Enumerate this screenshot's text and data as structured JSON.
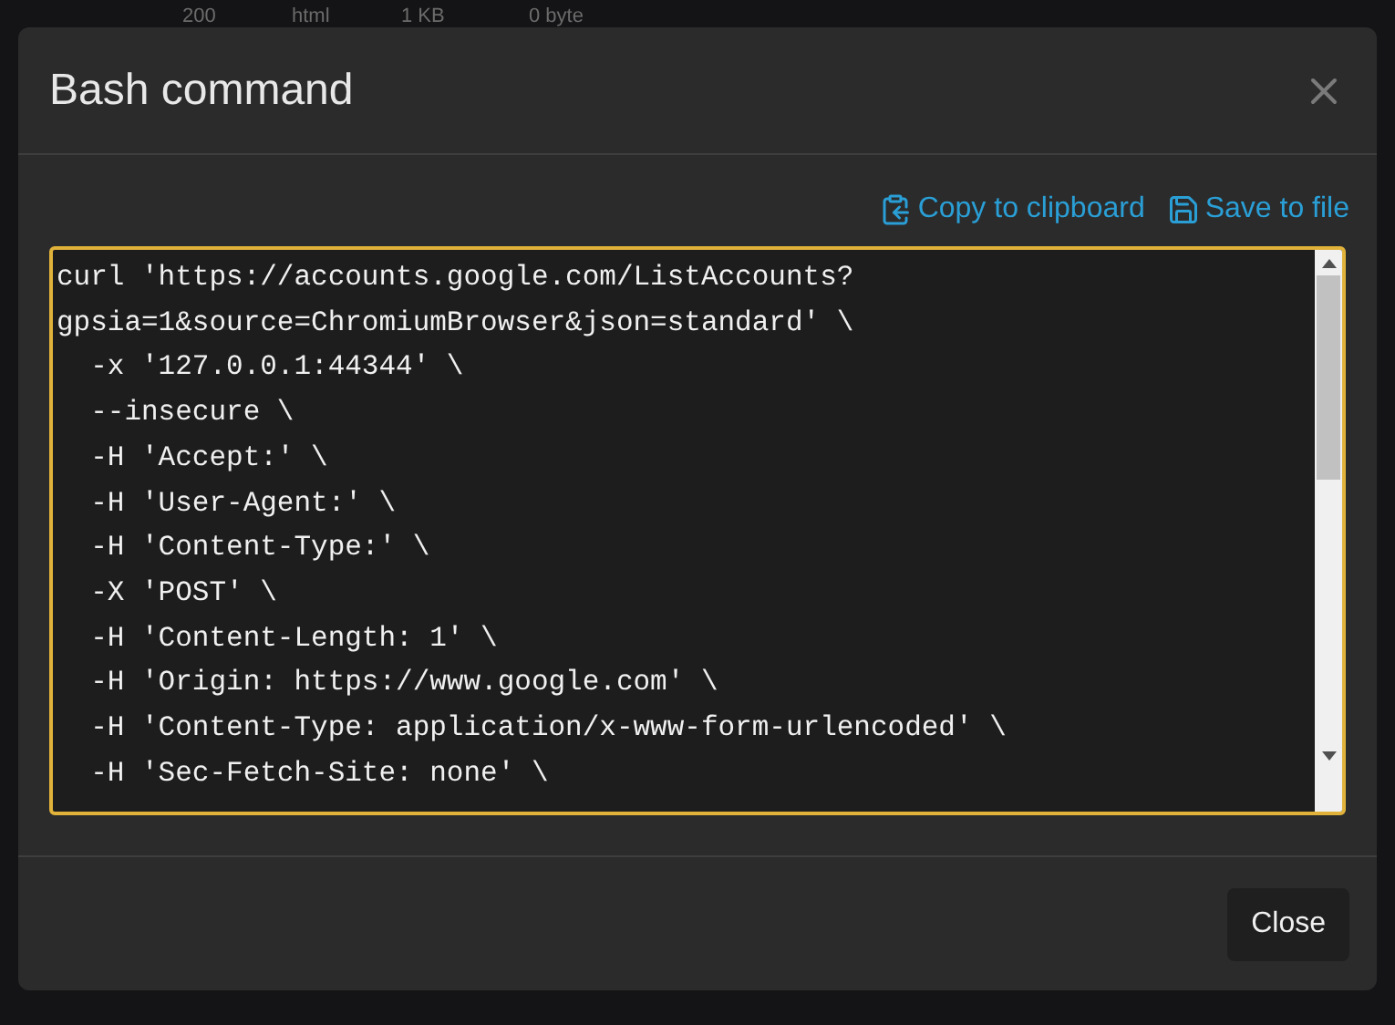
{
  "background_row": [
    "200",
    "html",
    "1 KB",
    "0 byte"
  ],
  "dialog": {
    "title": "Bash command",
    "actions": [
      "Copy to clipboard",
      "Save to file"
    ],
    "command_lines": [
      "curl 'https://accounts.google.com/ListAccounts?",
      "gpsia=1&source=ChromiumBrowser&json=standard' \\",
      "  -x '127.0.0.1:44344' \\",
      "  --insecure \\",
      "  -H 'Accept:' \\",
      "  -H 'User-Agent:' \\",
      "  -H 'Content-Type:' \\",
      "  -X 'POST' \\",
      "  -H 'Content-Length: 1' \\",
      "  -H 'Origin: https://www.google.com' \\",
      "  -H 'Content-Type: application/x-www-form-urlencoded' \\",
      "  -H 'Sec-Fetch-Site: none' \\"
    ],
    "close_button": "Close"
  }
}
